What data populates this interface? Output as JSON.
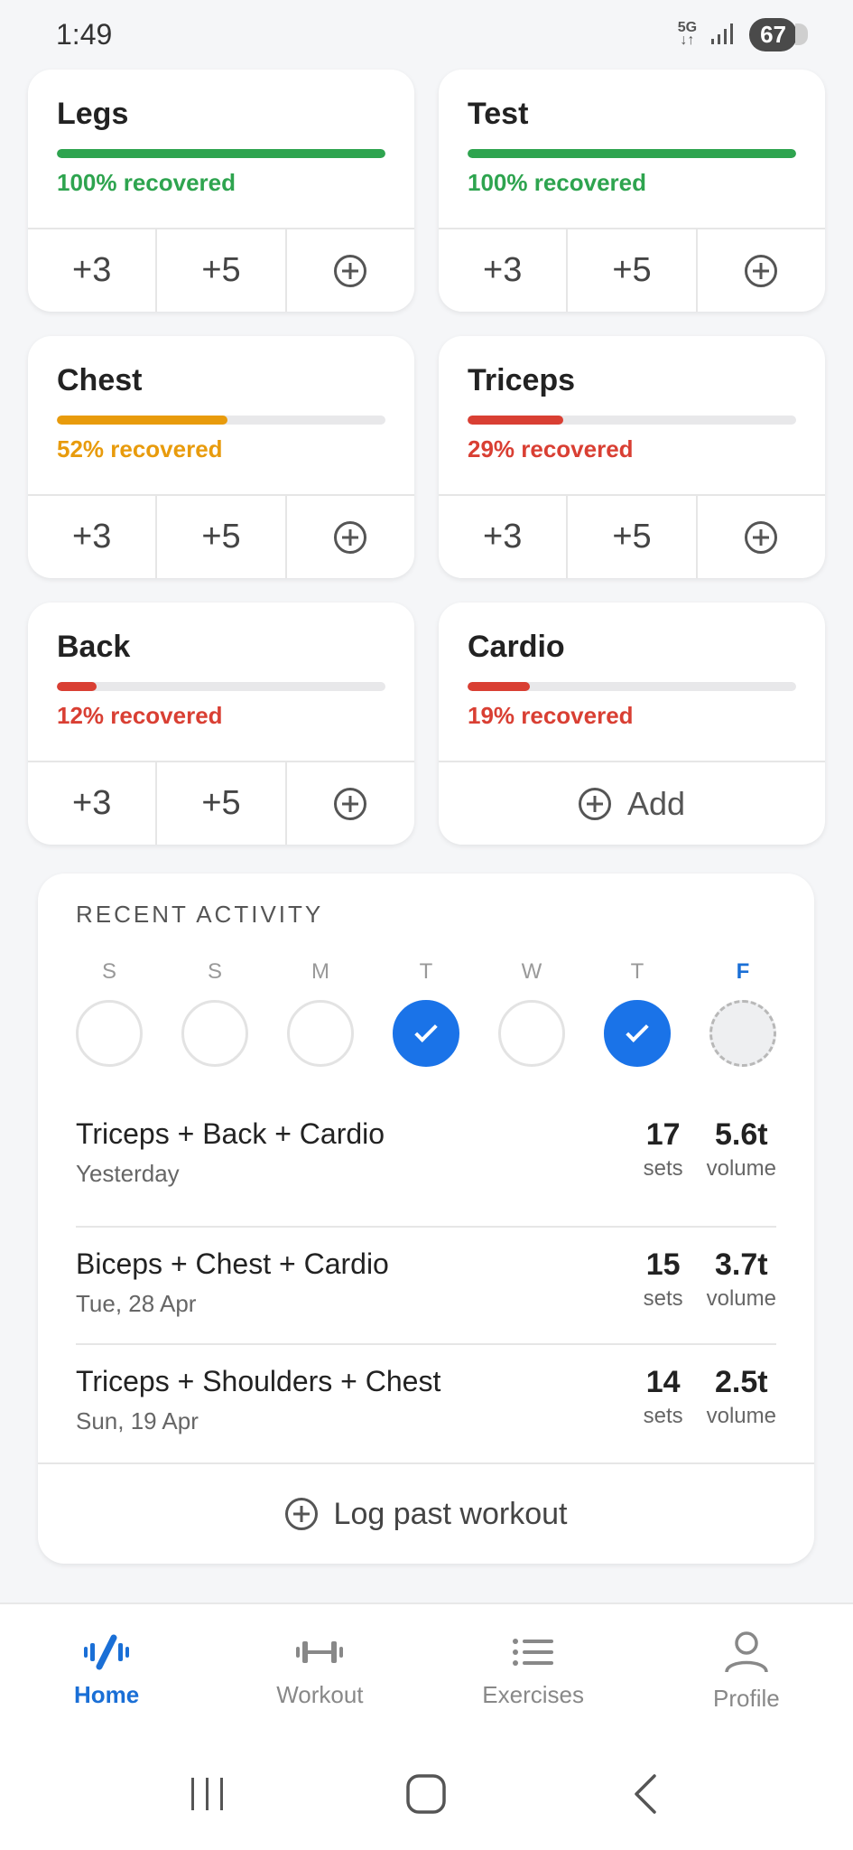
{
  "status_bar": {
    "time": "1:49",
    "network": "5G",
    "battery": "67"
  },
  "muscle_cards": [
    {
      "name": "Legs",
      "recovery": 100,
      "status": "100% recovered",
      "color": "#2ea44f",
      "actions": [
        "+3",
        "+5"
      ]
    },
    {
      "name": "Test",
      "recovery": 100,
      "status": "100% recovered",
      "color": "#2ea44f",
      "actions": [
        "+3",
        "+5"
      ]
    },
    {
      "name": "Chest",
      "recovery": 52,
      "status": "52% recovered",
      "color": "#e89b0c",
      "actions": [
        "+3",
        "+5"
      ]
    },
    {
      "name": "Triceps",
      "recovery": 29,
      "status": "29% recovered",
      "color": "#d93f33",
      "actions": [
        "+3",
        "+5"
      ]
    },
    {
      "name": "Back",
      "recovery": 12,
      "status": "12% recovered",
      "color": "#d93f33",
      "actions": [
        "+3",
        "+5"
      ]
    },
    {
      "name": "Cardio",
      "recovery": 19,
      "status": "19% recovered",
      "color": "#d93f33",
      "add_label": "Add"
    }
  ],
  "recent_activity": {
    "title": "RECENT ACTIVITY",
    "week": [
      {
        "letter": "S",
        "state": "empty"
      },
      {
        "letter": "S",
        "state": "empty"
      },
      {
        "letter": "M",
        "state": "empty"
      },
      {
        "letter": "T",
        "state": "done"
      },
      {
        "letter": "W",
        "state": "empty"
      },
      {
        "letter": "T",
        "state": "done"
      },
      {
        "letter": "F",
        "state": "today"
      }
    ],
    "workouts": [
      {
        "name": "Triceps + Back + Cardio",
        "date": "Yesterday",
        "sets": "17",
        "sets_label": "sets",
        "volume": "5.6t",
        "volume_label": "volume"
      },
      {
        "name": "Biceps + Chest + Cardio",
        "date": "Tue, 28 Apr",
        "sets": "15",
        "sets_label": "sets",
        "volume": "3.7t",
        "volume_label": "volume"
      },
      {
        "name": "Triceps + Shoulders + Chest",
        "date": "Sun, 19 Apr",
        "sets": "14",
        "sets_label": "sets",
        "volume": "2.5t",
        "volume_label": "volume"
      }
    ],
    "log_past_label": "Log past workout"
  },
  "bottom_nav": {
    "items": [
      {
        "label": "Home",
        "icon": "home-activity-icon",
        "active": true
      },
      {
        "label": "Workout",
        "icon": "dumbbell-icon",
        "active": false
      },
      {
        "label": "Exercises",
        "icon": "list-icon",
        "active": false
      },
      {
        "label": "Profile",
        "icon": "profile-icon",
        "active": false
      }
    ]
  },
  "colors": {
    "accent": "#1a73e8",
    "recovered_full": "#2ea44f",
    "recovered_mid": "#e89b0c",
    "recovered_low": "#d93f33"
  }
}
